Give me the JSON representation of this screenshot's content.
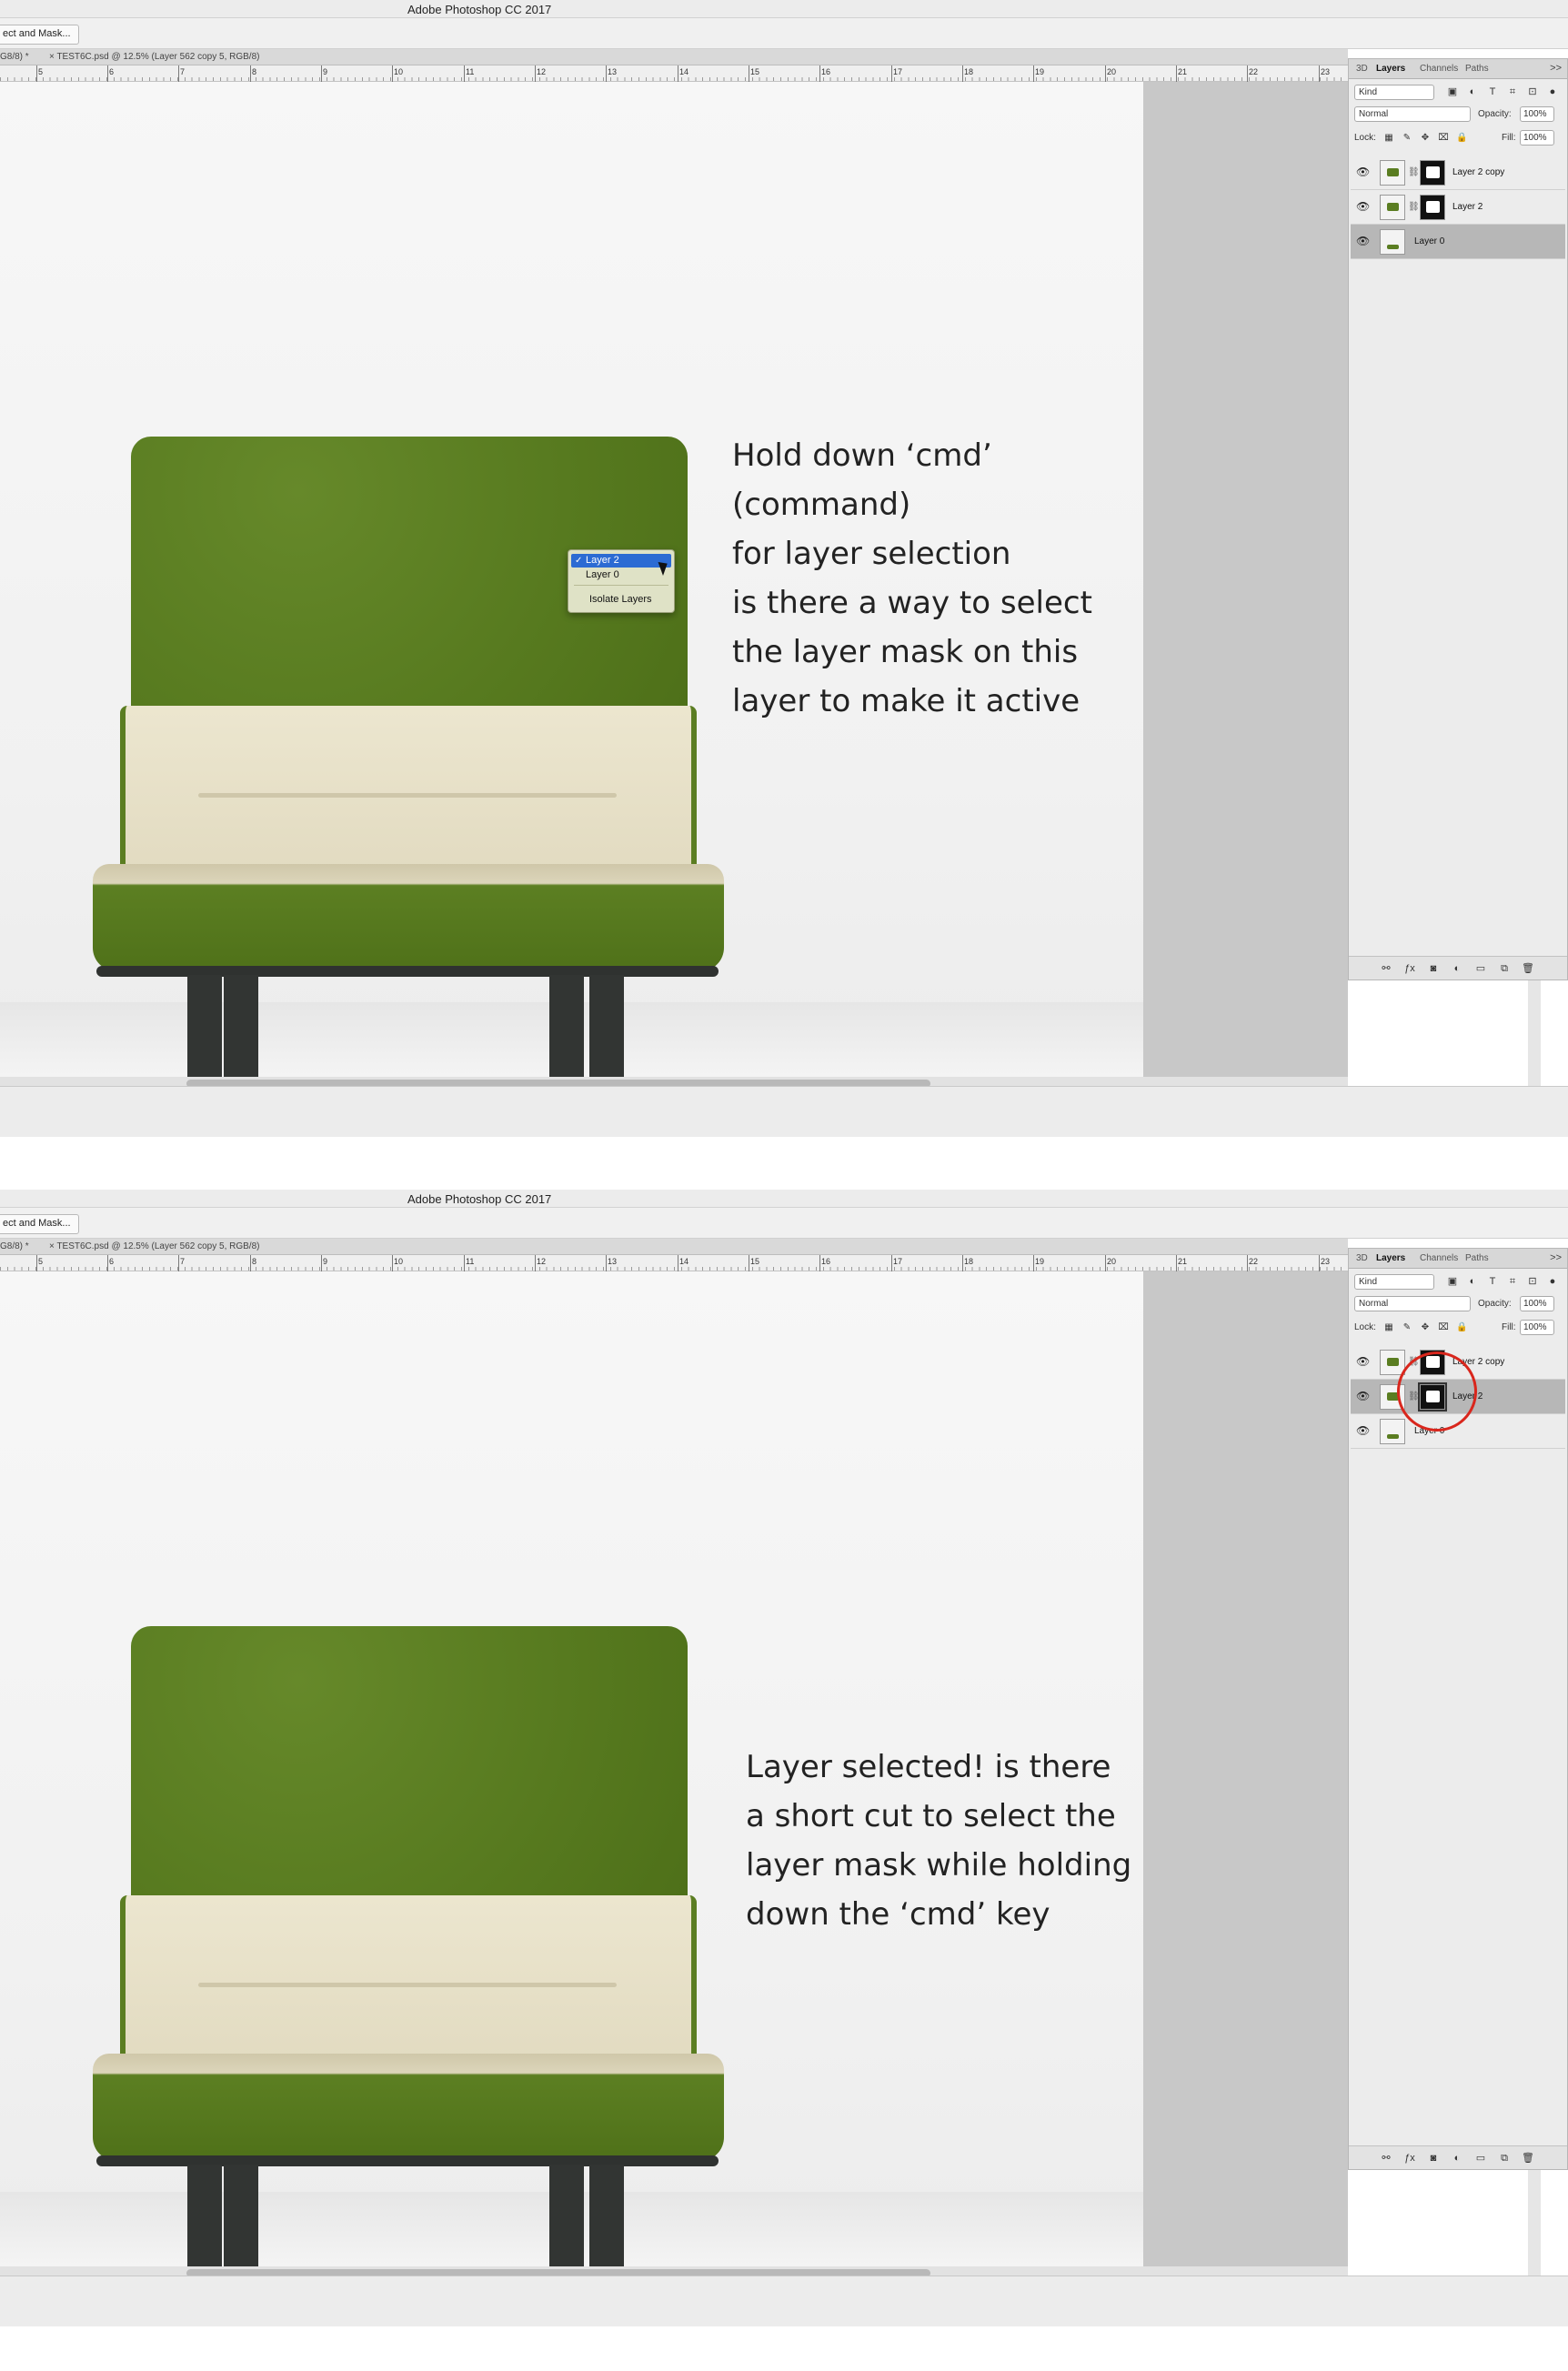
{
  "app_title": "Adobe Photoshop CC 2017",
  "options_bar": {
    "select_mask_button": "ect and Mask..."
  },
  "document_tabs": [
    "G8/8) *",
    "× TEST6C.psd @ 12.5% (Layer 562 copy 5, RGB/8)"
  ],
  "ruler_labels": [
    "5",
    "6",
    "7",
    "8",
    "9",
    "10",
    "11",
    "12",
    "13",
    "14",
    "15",
    "16",
    "17",
    "18",
    "19",
    "20",
    "21",
    "22",
    "23"
  ],
  "layers_panel": {
    "tabs": [
      "3D",
      "Layers",
      "Channels",
      "Paths"
    ],
    "menu_glyph": ">>",
    "kind_filter": "Kind",
    "blend_mode": "Normal",
    "opacity_label": "Opacity:",
    "opacity": "100%",
    "lock_label": "Lock:",
    "fill_label": "Fill:",
    "fill": "100%",
    "layers_before": [
      {
        "name": "Layer 2 copy",
        "visible": true,
        "has_mask": true,
        "selected": false
      },
      {
        "name": "Layer 2",
        "visible": true,
        "has_mask": true,
        "selected": false
      },
      {
        "name": "Layer 0",
        "visible": true,
        "has_mask": false,
        "selected": true
      }
    ],
    "layers_after": [
      {
        "name": "Layer 2 copy",
        "visible": true,
        "has_mask": true,
        "selected": false
      },
      {
        "name": "Layer 2",
        "visible": true,
        "has_mask": true,
        "selected": true
      },
      {
        "name": "Layer 0",
        "visible": true,
        "has_mask": false,
        "selected": false
      }
    ],
    "footer_icons": [
      "link-icon",
      "fx-icon",
      "mask-icon",
      "adjustment-icon",
      "folder-icon",
      "new-layer-icon",
      "trash-icon"
    ]
  },
  "context_menu": {
    "checked_item": "Layer 2",
    "items": [
      "Layer 2",
      "Layer 0"
    ],
    "extra_item": "Isolate Layers"
  },
  "annotations": {
    "shot1_lines": [
      "Hold down ‘cmd’",
      "(command)",
      "for layer selection",
      "is there a way to select",
      "the layer mask on this",
      "layer to make it active"
    ],
    "shot2_lines": [
      "Layer selected! is there",
      "a short cut to select the",
      "layer mask while holding",
      "down the ‘cmd’ key"
    ]
  },
  "colors": {
    "sofa_green": "#5a7d21",
    "cushion_cream": "#e5dfc8",
    "selected_menu_blue": "#2c6bd3",
    "highlight_circle_red": "#d9261c"
  }
}
